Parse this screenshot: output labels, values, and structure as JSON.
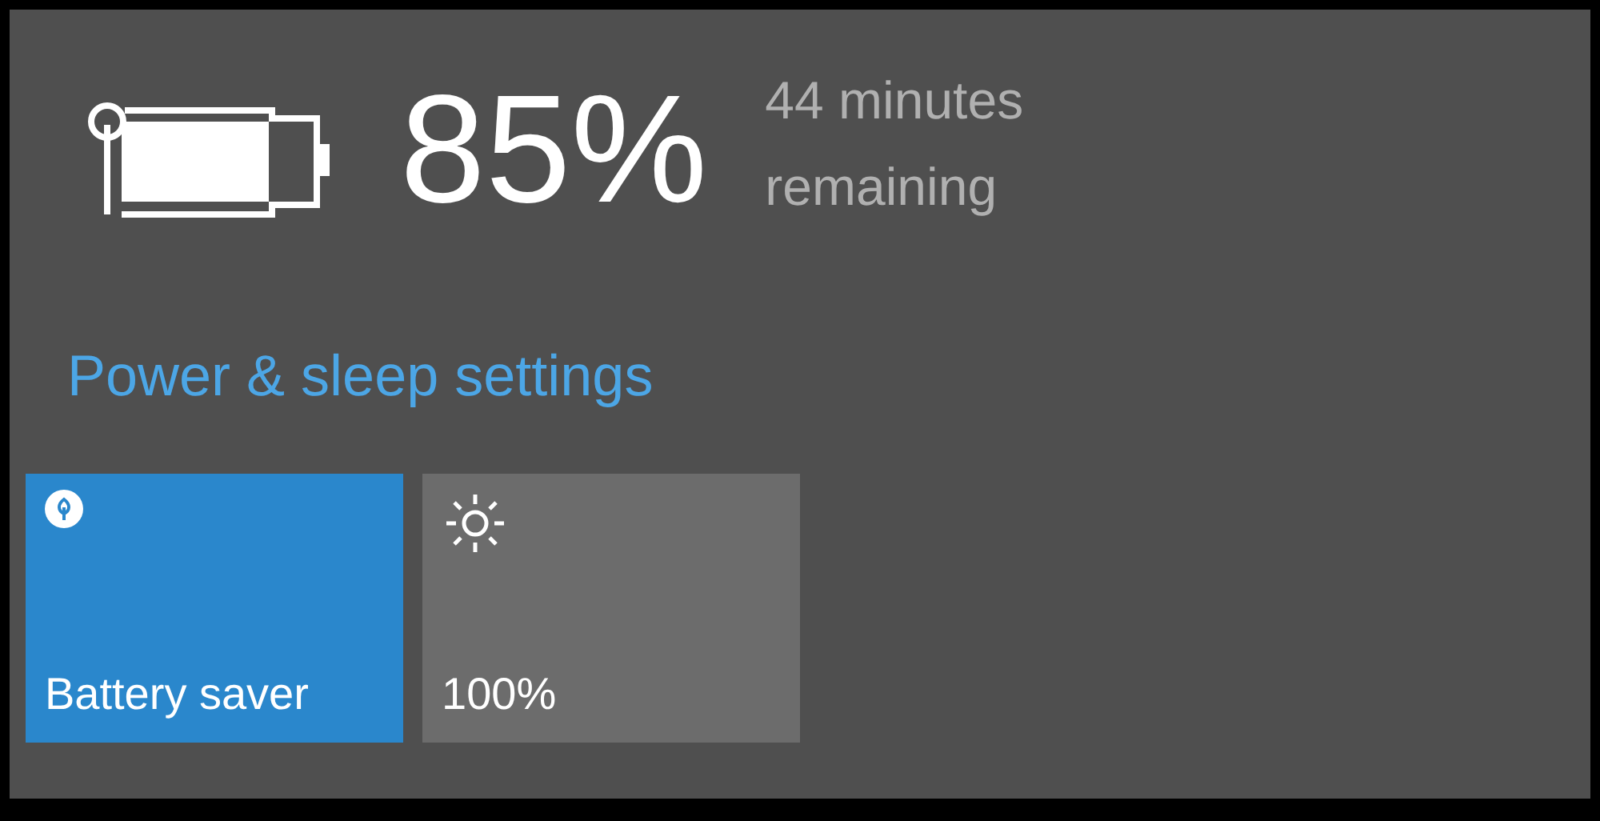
{
  "battery": {
    "percent": "85%",
    "remaining": [
      "44 minutes",
      "remaining"
    ]
  },
  "link": "Power & sleep settings",
  "tiles": [
    {
      "kind": "saver",
      "label": "Battery saver",
      "on": true
    },
    {
      "kind": "brightness",
      "label": "100%",
      "on": false
    }
  ]
}
